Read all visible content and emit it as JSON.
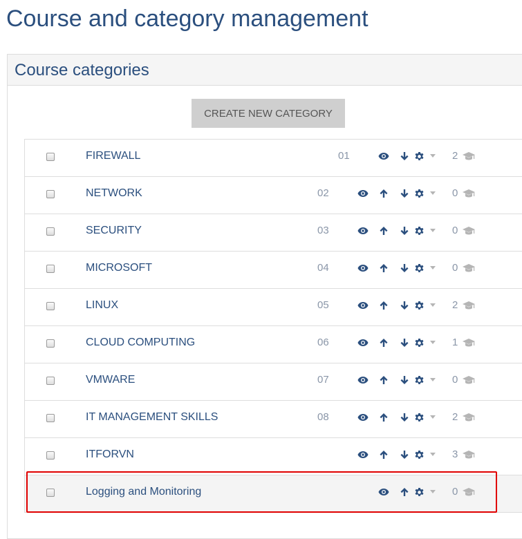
{
  "page": {
    "title": "Course and category management"
  },
  "panel": {
    "title": "Course categories",
    "create_button": "CREATE NEW CATEGORY"
  },
  "categories": [
    {
      "name": "FIREWALL",
      "idnumber": "01",
      "courses": "2",
      "show_up": false,
      "show_down": true
    },
    {
      "name": "NETWORK",
      "idnumber": "02",
      "courses": "0",
      "show_up": true,
      "show_down": true
    },
    {
      "name": "SECURITY",
      "idnumber": "03",
      "courses": "0",
      "show_up": true,
      "show_down": true
    },
    {
      "name": "MICROSOFT",
      "idnumber": "04",
      "courses": "0",
      "show_up": true,
      "show_down": true
    },
    {
      "name": "LINUX",
      "idnumber": "05",
      "courses": "2",
      "show_up": true,
      "show_down": true
    },
    {
      "name": "CLOUD COMPUTING",
      "idnumber": "06",
      "courses": "1",
      "show_up": true,
      "show_down": true
    },
    {
      "name": "VMWARE",
      "idnumber": "07",
      "courses": "0",
      "show_up": true,
      "show_down": true
    },
    {
      "name": "IT MANAGEMENT SKILLS",
      "idnumber": "08",
      "courses": "2",
      "show_up": true,
      "show_down": true
    },
    {
      "name": "ITFORVN",
      "idnumber": "",
      "courses": "3",
      "show_up": true,
      "show_down": true
    },
    {
      "name": "Logging and Monitoring",
      "idnumber": "",
      "courses": "0",
      "show_up": true,
      "show_down": false
    }
  ],
  "icons": {
    "view": "eye-icon",
    "move_up": "arrow-up-icon",
    "move_down": "arrow-down-icon",
    "settings": "gear-icon",
    "menu": "caret-down-icon",
    "courses": "graduation-cap-icon"
  },
  "colors": {
    "link": "#2b4f7e",
    "muted": "#8a96a8",
    "button_bg": "#cfcfcf",
    "highlight_border": "#e00000"
  }
}
